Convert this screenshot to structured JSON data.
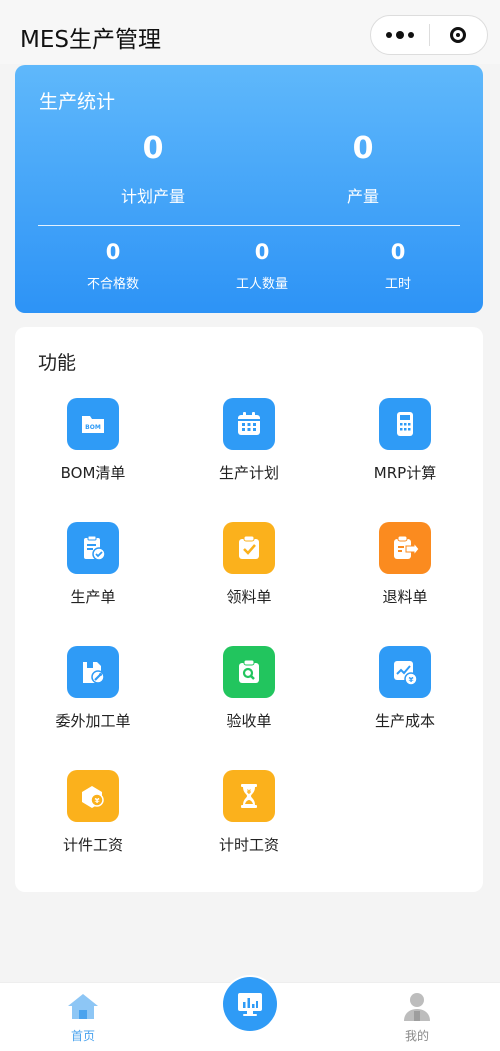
{
  "app": {
    "title": "MES生产管理"
  },
  "stats": {
    "title": "生产统计",
    "planned_output": {
      "value": "0",
      "label": "计划产量"
    },
    "output": {
      "value": "0",
      "label": "产量"
    },
    "defects": {
      "value": "0",
      "label": "不合格数"
    },
    "workers": {
      "value": "0",
      "label": "工人数量"
    },
    "hours": {
      "value": "0",
      "label": "工时"
    }
  },
  "functions": {
    "title": "功能",
    "items": [
      {
        "label": "BOM清单",
        "icon": "bom-folder-icon",
        "color": "#2f9bf6"
      },
      {
        "label": "生产计划",
        "icon": "calendar-icon",
        "color": "#2f9bf6"
      },
      {
        "label": "MRP计算",
        "icon": "calculator-icon",
        "color": "#2f9bf6"
      },
      {
        "label": "生产单",
        "icon": "clipboard-check-icon",
        "color": "#2f9bf6"
      },
      {
        "label": "领料单",
        "icon": "material-receipt-icon",
        "color": "#fbb11c"
      },
      {
        "label": "退料单",
        "icon": "material-return-icon",
        "color": "#fb8b1f"
      },
      {
        "label": "委外加工单",
        "icon": "outsource-wrench-icon",
        "color": "#2f9bf6"
      },
      {
        "label": "验收单",
        "icon": "inspection-search-icon",
        "color": "#22c55e"
      },
      {
        "label": "生产成本",
        "icon": "cost-chart-icon",
        "color": "#2f9bf6"
      },
      {
        "label": "计件工资",
        "icon": "piece-wage-icon",
        "color": "#fbb11c"
      },
      {
        "label": "计时工资",
        "icon": "hourglass-wage-icon",
        "color": "#fbb11c"
      }
    ]
  },
  "tabbar": {
    "home": {
      "label": "首页",
      "icon": "home-icon"
    },
    "center": {
      "icon": "dashboard-icon"
    },
    "mine": {
      "label": "我的",
      "icon": "user-icon"
    }
  },
  "colors": {
    "accent": "#2f9bf6",
    "gradient_top": "#5fb8fb",
    "gradient_bottom": "#2d93f6"
  }
}
